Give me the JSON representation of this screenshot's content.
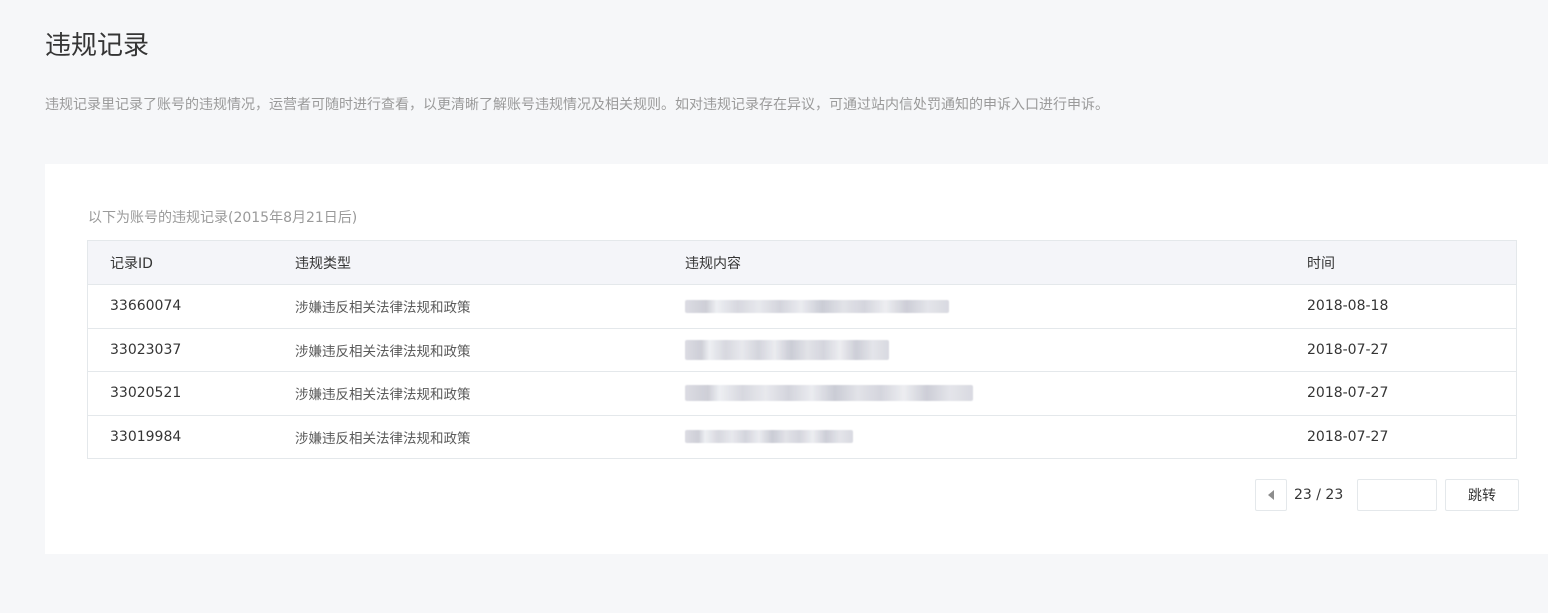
{
  "page": {
    "title": "违规记录",
    "description": "违规记录里记录了账号的违规情况，运营者可随时进行查看，以更清晰了解账号违规情况及相关规则。如对违规记录存在异议，可通过站内信处罚通知的申诉入口进行申诉。"
  },
  "records": {
    "subtitle": "以下为账号的违规记录(2015年8月21日后)",
    "columns": {
      "id": "记录ID",
      "type": "违规类型",
      "content": "违规内容",
      "time": "时间"
    },
    "rows": [
      {
        "id": "33660074",
        "type": "涉嫌违反相关法律法规和政策",
        "content_blurred": true,
        "time": "2018-08-18"
      },
      {
        "id": "33023037",
        "type": "涉嫌违反相关法律法规和政策",
        "content_blurred": true,
        "time": "2018-07-27"
      },
      {
        "id": "33020521",
        "type": "涉嫌违反相关法律法规和政策",
        "content_blurred": true,
        "time": "2018-07-27"
      },
      {
        "id": "33019984",
        "type": "涉嫌违反相关法律法规和政策",
        "content_blurred": true,
        "time": "2018-07-27"
      }
    ]
  },
  "pagination": {
    "prev_icon": "triangle-left-icon",
    "page_count": "23 / 23",
    "jump_input_value": "",
    "jump_input_placeholder": "",
    "jump_label": "跳转"
  },
  "colors": {
    "page_background": "#f6f7f9",
    "panel_background": "#ffffff",
    "table_header_background": "#f4f5f9",
    "border": "#e4e8eb",
    "muted_text": "#9a9a9a",
    "primary_text": "#353535"
  }
}
